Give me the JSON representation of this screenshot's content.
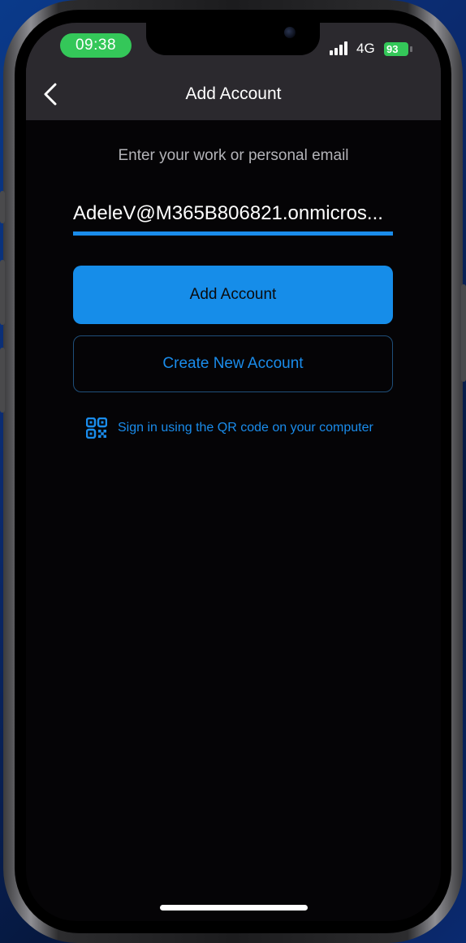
{
  "status_bar": {
    "time": "09:38",
    "network_type": "4G",
    "battery_percent": "93",
    "signal_bars": 4
  },
  "nav": {
    "title": "Add Account",
    "back_icon": "chevron-left-icon"
  },
  "form": {
    "prompt": "Enter your work or personal email",
    "email_value": "AdeleV@M365B806821.onmicros...",
    "add_account_label": "Add Account",
    "create_account_label": "Create New Account",
    "qr_signin_label": "Sign in using the QR code on your computer",
    "qr_icon": "qr-code-icon"
  },
  "colors": {
    "accent": "#168de9",
    "link": "#1a8ceb",
    "time_pill": "#34c759",
    "nav_background": "#2b292e",
    "screen_background": "#050406"
  }
}
